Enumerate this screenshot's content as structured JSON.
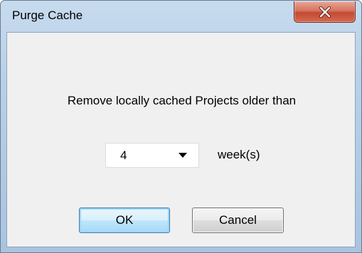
{
  "window": {
    "title": "Purge Cache"
  },
  "message": "Remove locally cached Projects older than",
  "age_select": {
    "value": "4",
    "unit_label": "week(s)"
  },
  "buttons": {
    "ok": "OK",
    "cancel": "Cancel"
  },
  "icons": {
    "close": "close-icon",
    "dropdown": "chevron-down-icon"
  },
  "colors": {
    "close_button": "#c24a33",
    "default_button_border": "#3c7fb1",
    "dialog_background": "#f0f0f0"
  }
}
